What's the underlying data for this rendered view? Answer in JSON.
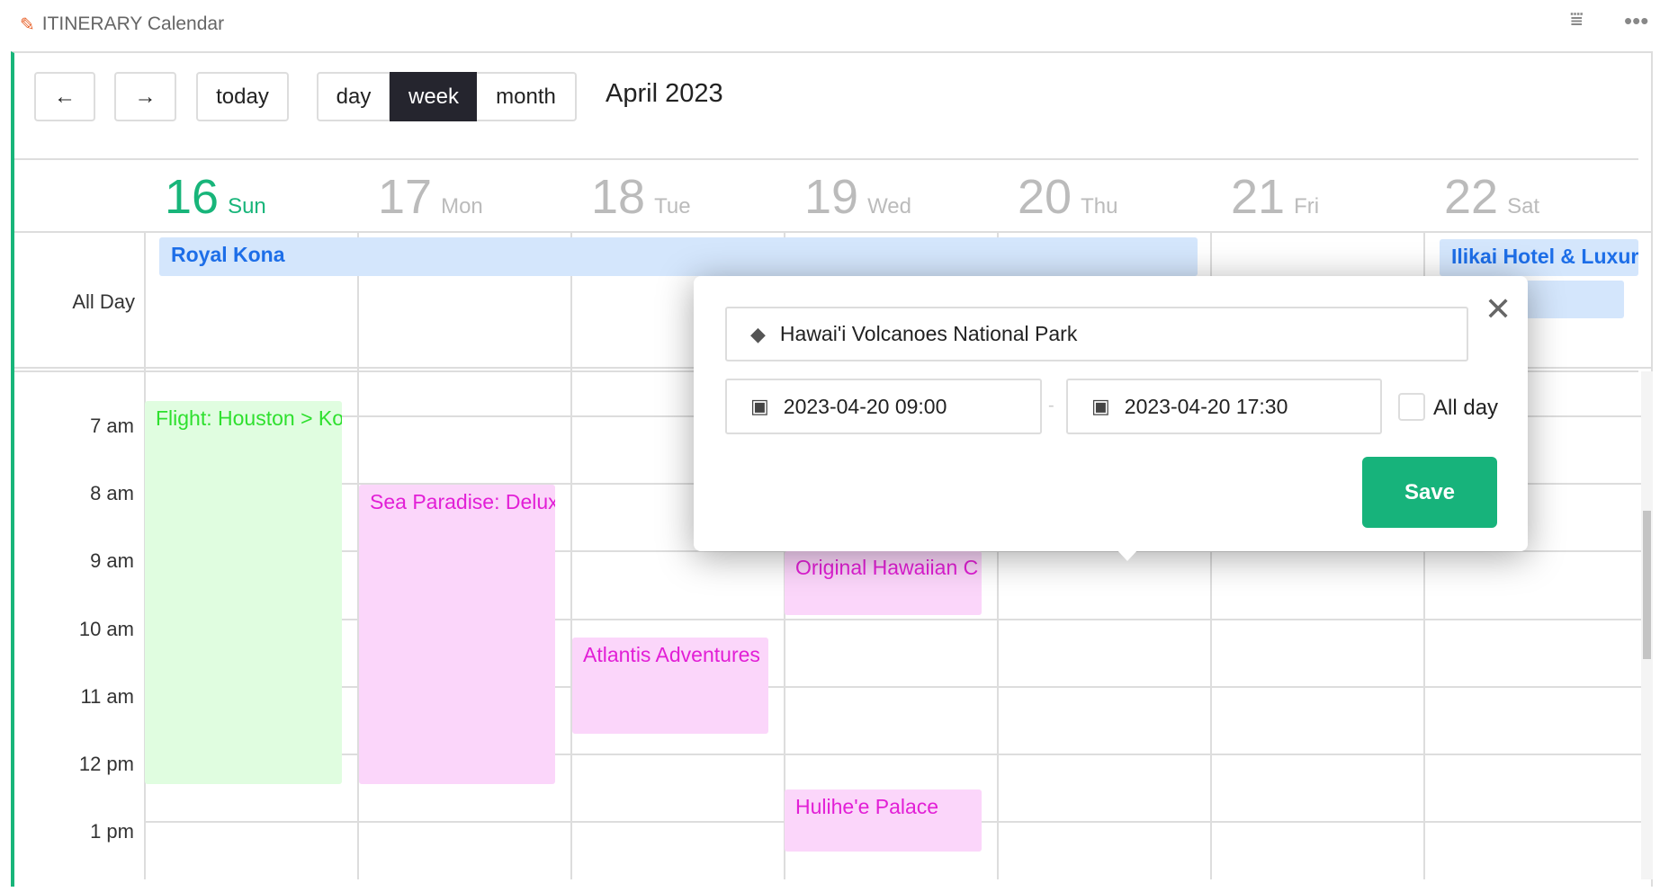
{
  "app": {
    "title": "ITINERARY Calendar",
    "icons": [
      "document-edit-icon",
      "filter-icon",
      "more-icon"
    ]
  },
  "toolbar": {
    "prev": "←",
    "next": "→",
    "today": "today",
    "views": [
      "day",
      "week",
      "month"
    ],
    "active_view": "week",
    "period": "April 2023"
  },
  "days": [
    {
      "num": "16",
      "name": "Sun",
      "today": true
    },
    {
      "num": "17",
      "name": "Mon"
    },
    {
      "num": "18",
      "name": "Tue"
    },
    {
      "num": "19",
      "name": "Wed"
    },
    {
      "num": "20",
      "name": "Thu"
    },
    {
      "num": "21",
      "name": "Fri"
    },
    {
      "num": "22",
      "name": "Sat"
    }
  ],
  "allday_label": "All Day",
  "hours": [
    "7 am",
    "8 am",
    "9 am",
    "10 am",
    "11 am",
    "12 pm",
    "1 pm"
  ],
  "allday_events": [
    {
      "title": "Royal Kona",
      "color": "#d4e6fc"
    },
    {
      "title": "Ilikai Hotel & Luxury",
      "color": "#d4e6fc"
    }
  ],
  "events": [
    {
      "title": "Flight: Houston > Kona",
      "color": "#e0fde0",
      "text_color": "#2ee02e"
    },
    {
      "title": "Sea Paradise: Deluxe",
      "color": "#fbd6fa",
      "text_color": "#e21fd6"
    },
    {
      "title": "Atlantis Adventures",
      "color": "#fbd6fa",
      "text_color": "#e21fd6"
    },
    {
      "title": "Original Hawaiian C",
      "color": "#fbd6fa",
      "text_color": "#e21fd6"
    },
    {
      "title": "Hulihe'e Palace",
      "color": "#fbd6fa",
      "text_color": "#e21fd6"
    }
  ],
  "popup": {
    "name": "Hawai'i Volcanoes National Park",
    "start": "2023-04-20 09:00",
    "separator": "-",
    "end": "2023-04-20 17:30",
    "allday_label": "All day",
    "allday_checked": false,
    "save": "Save",
    "accent": "#17b37b"
  }
}
